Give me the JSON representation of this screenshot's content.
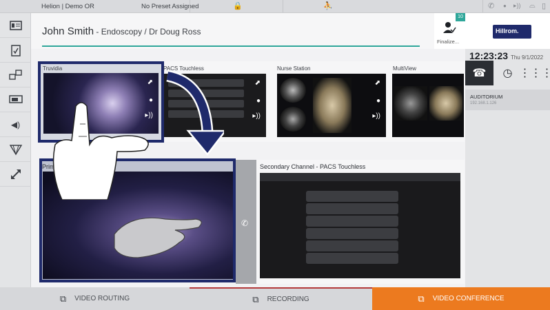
{
  "topbar": {
    "room": "Helion | Demo OR",
    "preset": "No Preset Assigned"
  },
  "header": {
    "patient_name": "John Smith",
    "patient_detail": " - Endoscopy / Dr Doug Ross",
    "finalize_label": "Finalize...",
    "finalize_badge": "10"
  },
  "sources": [
    {
      "title": "Truvidia"
    },
    {
      "title": "PACS Touchless"
    },
    {
      "title": "Nurse Station"
    },
    {
      "title": "MultiView"
    }
  ],
  "primary": {
    "title": "Primary Channel - Truvidia"
  },
  "secondary": {
    "title": "Secondary Channel - PACS Touchless"
  },
  "right_panel": {
    "logo": "Hillrom.",
    "time": "12:23:23",
    "date": "Thu 9/1/2022",
    "directory_name": "AUDITORIUM",
    "directory_number": "192.168.1.126"
  },
  "bottom_tabs": [
    {
      "label": "VIDEO ROUTING"
    },
    {
      "label": "RECORDING"
    },
    {
      "label": "VIDEO CONFERENCE"
    }
  ],
  "colors": {
    "accent": "#2fa79a",
    "selection": "#1f2a6b",
    "active_tab": "#ec7a1f"
  },
  "icons": {
    "sidebar": [
      "patient-card-icon",
      "checklist-icon",
      "video-routing-icon",
      "monitor-icon",
      "volume-icon",
      "surgical-light-icon",
      "fullscreen-icon"
    ]
  }
}
